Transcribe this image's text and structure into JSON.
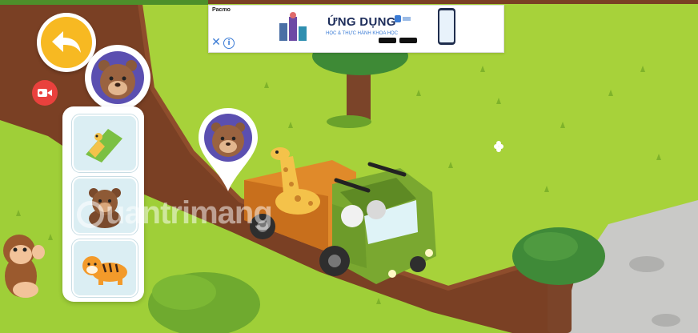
{
  "ad": {
    "brand": "Pacmo",
    "title": "ỨNG DỤNG",
    "subtitle": "HỌC & THỰC HÀNH KHOA HỌC",
    "close_symbol": "✕",
    "info_symbol": "i",
    "logo_name": "stem-logo-icon",
    "store_badges": [
      "app-store-badge",
      "google-play-badge"
    ]
  },
  "watermark": {
    "text": "uantrimang"
  },
  "ui": {
    "back_button_icon": "back-arrow-icon",
    "record_button_icon": "video-camera-icon",
    "avatar_icon": "bear-face-icon",
    "map_pin_icon": "bear-pin-icon"
  },
  "inventory": [
    {
      "name": "giraffe-card",
      "icon": "giraffe-neck-icon"
    },
    {
      "name": "bear-card",
      "icon": "bear-bust-icon"
    },
    {
      "name": "tiger-card",
      "icon": "tiger-icon"
    }
  ],
  "scene": {
    "vehicle": "green-safari-truck",
    "cargo": "giraffe",
    "characters": [
      "monkey",
      "bear-driver"
    ]
  },
  "colors": {
    "grass": "#a8d43a",
    "road": "#7a3f22",
    "back_button": "#f7b922",
    "record_button": "#e9413d",
    "truck": "#7aa830"
  }
}
